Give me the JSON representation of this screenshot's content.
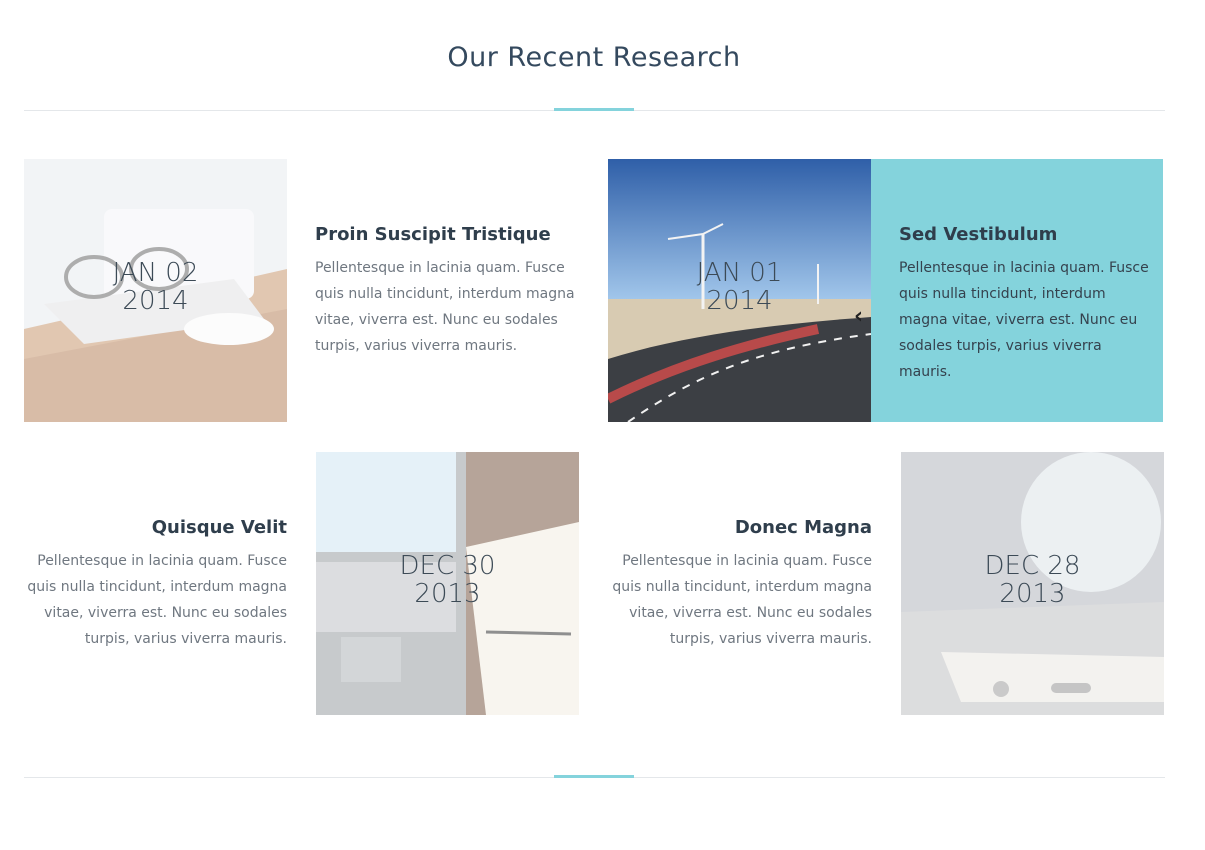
{
  "section": {
    "title": "Our Recent Research"
  },
  "posts": [
    {
      "title": "Proin Suscipit Tristique",
      "date_month_day": "JAN 02",
      "date_year": "2014",
      "body": "Pellentesque in lacinia quam. Fusce quis nulla tincidunt, interdum magna vitae, viverra est. Nunc eu sodales turpis, varius viverra mauris.",
      "image": "glasses-on-laptop-photo"
    },
    {
      "title": "Sed Vestibulum",
      "date_month_day": "JAN 01",
      "date_year": "2014",
      "body": "Pellentesque in lacinia quam. Fusce quis nulla tincidunt, interdum magna vitae, viverra est. Nunc eu sodales turpis, varius viverra mauris.",
      "image": "road-wind-turbines-photo",
      "highlighted": true
    },
    {
      "title": "Quisque Velit",
      "date_month_day": "DEC 30",
      "date_year": "2013",
      "body": "Pellentesque in lacinia quam. Fusce quis nulla tincidunt, interdum magna vitae, viverra est. Nunc eu sodales turpis, varius viverra mauris.",
      "image": "laptop-notebook-desk-photo"
    },
    {
      "title": "Donec Magna",
      "date_month_day": "DEC 28",
      "date_year": "2013",
      "body": "Pellentesque in lacinia quam. Fusce quis nulla tincidunt, interdum magna vitae, viverra est. Nunc eu sodales turpis, varius viverra mauris.",
      "image": "smartphone-closeup-photo"
    }
  ],
  "colors": {
    "accent": "#84d3dc",
    "heading": "#34495e",
    "body_text": "#6f7780",
    "divider": "#e4e7ea"
  }
}
